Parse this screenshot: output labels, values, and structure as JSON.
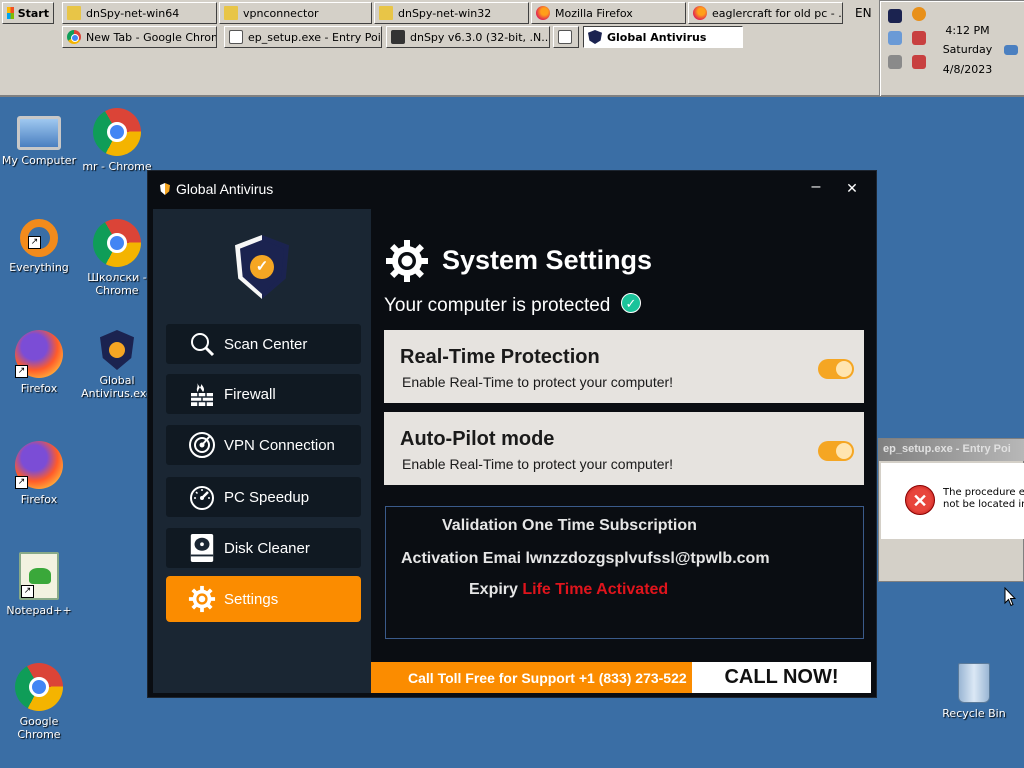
{
  "taskbar": {
    "start_label": "Start",
    "row1": [
      {
        "label": "dnSpy-net-win64",
        "icon": "folder-icon"
      },
      {
        "label": "vpnconnector",
        "icon": "folder-icon"
      },
      {
        "label": "dnSpy-net-win32",
        "icon": "folder-icon"
      },
      {
        "label": "Mozilla Firefox",
        "icon": "firefox-icon"
      },
      {
        "label": "eaglercraft for old pc - ...",
        "icon": "firefox-icon"
      }
    ],
    "row2": [
      {
        "label": "New Tab - Google Chrome",
        "icon": "chrome-icon"
      },
      {
        "label": "ep_setup.exe - Entry Poi...",
        "icon": "app-icon"
      },
      {
        "label": "dnSpy v6.3.0 (32-bit, .N...",
        "icon": "dnspy-icon"
      },
      {
        "label": "",
        "icon": "window-icon"
      },
      {
        "label": "Global Antivirus",
        "icon": "shield-icon"
      }
    ],
    "language": "EN",
    "clock": {
      "time": "4:12 PM",
      "day": "Saturday",
      "date": "4/8/2023"
    }
  },
  "desktop_icons": [
    {
      "label": "My Computer",
      "icon": "computer-icon"
    },
    {
      "label": "mr - Chrome",
      "icon": "chrome-icon"
    },
    {
      "label": "Everything",
      "icon": "everything-icon"
    },
    {
      "label": "Школски - Chrome",
      "icon": "chrome-icon"
    },
    {
      "label": "Firefox",
      "icon": "firefox-icon"
    },
    {
      "label": "Global Antivirus.exe",
      "icon": "shield-icon"
    },
    {
      "label": "Firefox",
      "icon": "firefox-icon"
    },
    {
      "label": "Notepad++",
      "icon": "notepad-icon"
    },
    {
      "label": "Google Chrome",
      "icon": "chrome-icon"
    },
    {
      "label": "Recycle Bin",
      "icon": "recycle-bin-icon"
    }
  ],
  "antivirus": {
    "window_title": "Global Antivirus",
    "minimize_glyph": "–",
    "close_glyph": "✕",
    "nav": [
      {
        "label": "Scan Center",
        "icon": "magnifier-icon"
      },
      {
        "label": "Firewall",
        "icon": "firewall-icon"
      },
      {
        "label": "VPN Connection",
        "icon": "radar-icon"
      },
      {
        "label": "PC Speedup",
        "icon": "speedometer-icon"
      },
      {
        "label": "Disk Cleaner",
        "icon": "disk-icon"
      },
      {
        "label": "Settings",
        "icon": "gear-icon",
        "active": true
      }
    ],
    "main": {
      "title": "System Settings",
      "status": "Your computer is protected",
      "cards": [
        {
          "title": "Real-Time Protection",
          "description": "Enable Real-Time to protect your computer!",
          "enabled": true
        },
        {
          "title": "Auto-Pilot mode",
          "description": "Enable Real-Time to protect your computer!",
          "enabled": true
        }
      ],
      "subscription": {
        "heading": "Validation One Time Subscription",
        "email_label": "Activation Emai",
        "email_value": "lwnzzdozgsplvufssl@tpwlb.com",
        "expiry_label": "Expiry",
        "expiry_value": "Life Time Activated"
      },
      "support_text": "Call Toll Free for Support +1 (833) 273-522",
      "call_button": "CALL NOW!"
    },
    "colors": {
      "accent": "#fb8c00",
      "sidebar": "#1a2633",
      "background": "#0a0d12",
      "check": "#1bc39a",
      "expiry": "#e0141c"
    }
  },
  "error_dialog": {
    "title": "ep_setup.exe - Entry Poi",
    "message_line1": "The procedure en",
    "message_line2": "not be located in"
  }
}
